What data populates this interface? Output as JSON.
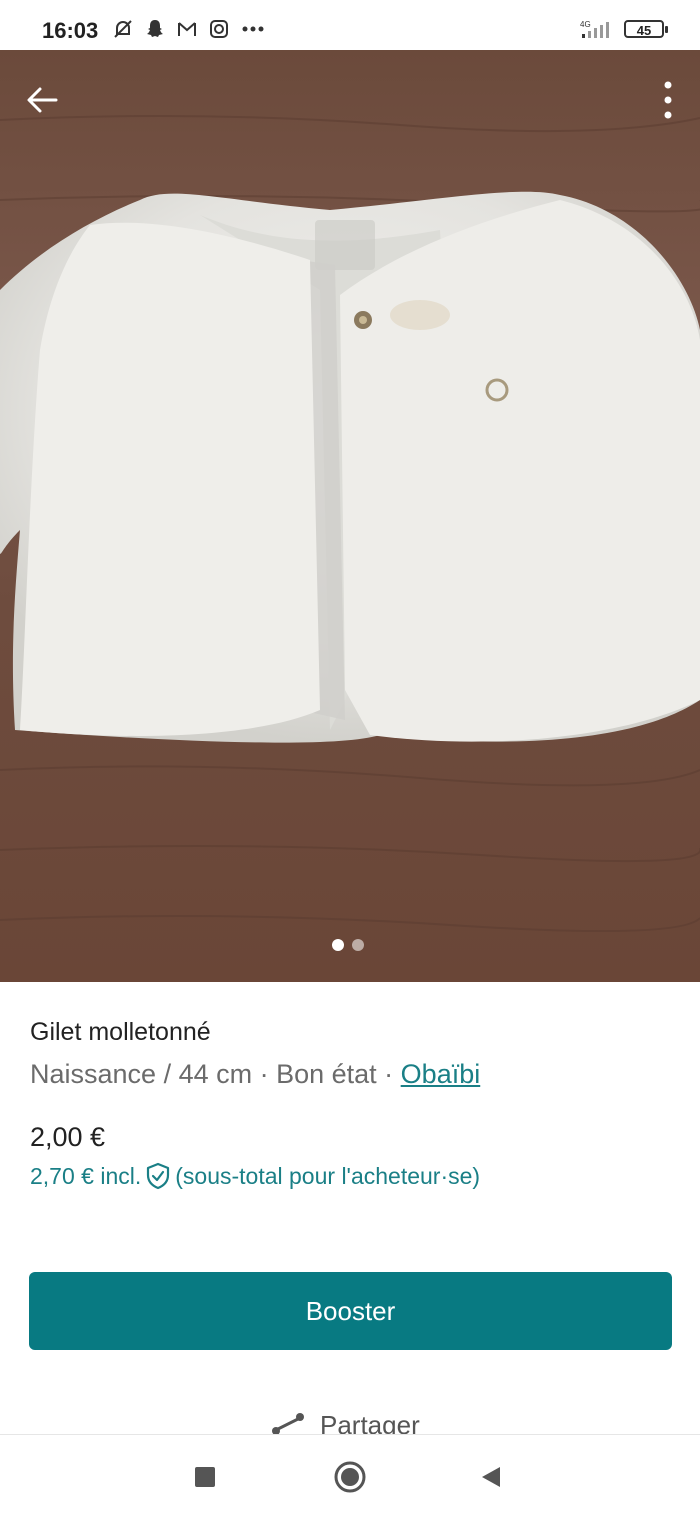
{
  "status_bar": {
    "time": "16:03",
    "network": "4G",
    "battery": "45"
  },
  "photo": {
    "icons": [
      "back-arrow-icon",
      "more-vertical-icon"
    ],
    "pager": {
      "total": 2,
      "current": 1
    }
  },
  "listing": {
    "title": "Gilet molletonné",
    "size": "Naissance / 44 cm",
    "separator": " · ",
    "condition": "Bon état",
    "brand": "Obaïbi",
    "price": "2,00 €",
    "price_incl_prefix": "2,70 € incl.",
    "price_incl_suffix": "(sous-total pour l'acheteur·se)"
  },
  "actions": {
    "boost_label": "Booster",
    "share_label": "Partager"
  },
  "colors": {
    "accent": "#087a82",
    "link": "#1a7f86"
  }
}
